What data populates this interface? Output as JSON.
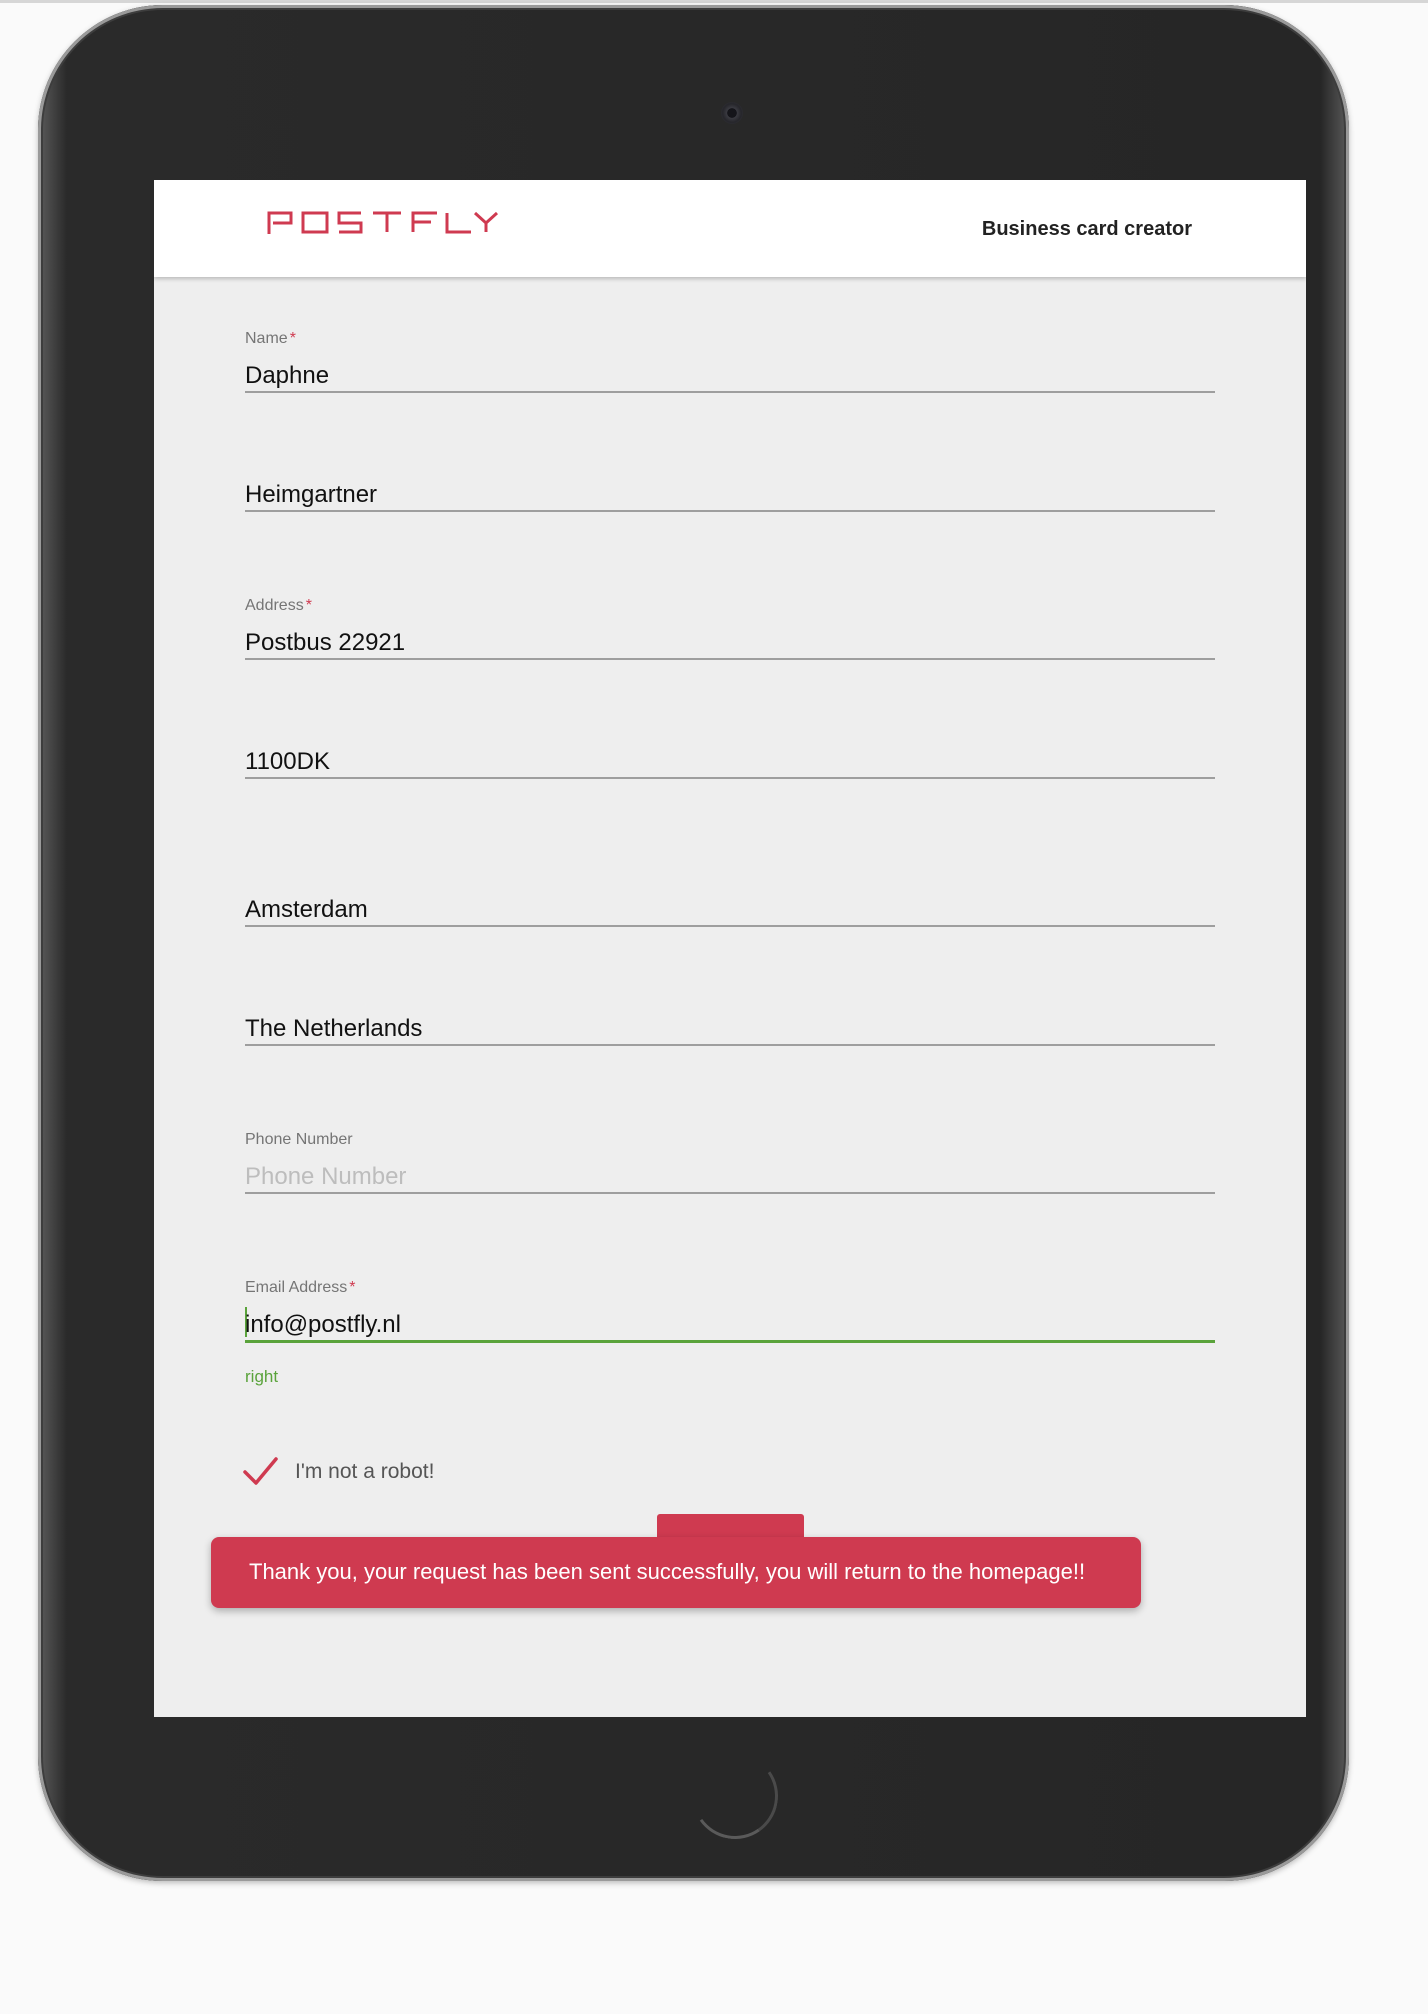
{
  "brand": {
    "logo_text": "POSTFLY",
    "accent_color": "#cf3a50"
  },
  "header": {
    "title": "Business card creator"
  },
  "form": {
    "name": {
      "label": "Name",
      "required_mark": "*",
      "value": "Daphne"
    },
    "last_name": {
      "value": "Heimgartner"
    },
    "address": {
      "label": "Address",
      "required_mark": "*",
      "value": "Postbus 22921"
    },
    "postal_code": {
      "value": "1100DK"
    },
    "city": {
      "value": "Amsterdam"
    },
    "country": {
      "value": "The Netherlands"
    },
    "phone": {
      "label": "Phone Number",
      "placeholder": "Phone Number",
      "value": ""
    },
    "email": {
      "label": "Email Address",
      "required_mark": "*",
      "value": "info@postfly.nl",
      "helper": "right"
    },
    "robot_check": {
      "label": "I'm not a robot!",
      "checked": true
    }
  },
  "toast": {
    "message": "Thank you, your request has been sent successfully, you will return to the homepage!!"
  },
  "colors": {
    "valid_green": "#5aa33b",
    "screen_bg": "#eeeeee",
    "device_frame": "#262626"
  }
}
